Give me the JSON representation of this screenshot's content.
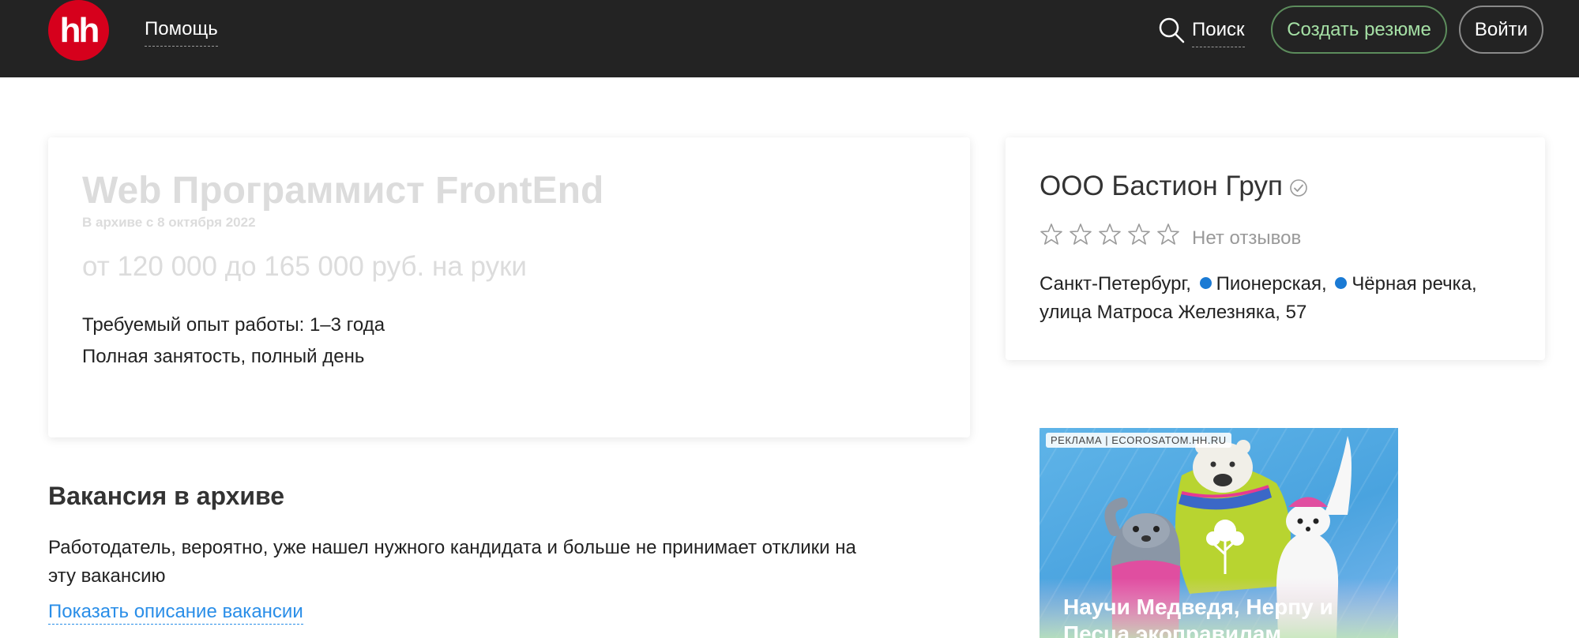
{
  "header": {
    "logo_text": "hh",
    "help_label": "Помощь",
    "search_label": "Поиск",
    "create_resume_label": "Создать резюме",
    "login_label": "Войти"
  },
  "vacancy": {
    "title": "Web Программист FrontEnd",
    "archived_note": "В архиве с 8 октября 2022",
    "salary": "от 120 000 до 165 000 руб. на руки",
    "experience": "Требуемый опыт работы: 1–3 года",
    "employment": "Полная занятость, полный день"
  },
  "archive_notice": {
    "heading": "Вакансия в архиве",
    "text": "Работодатель, вероятно, уже нашел нужного кандидата и больше не принимает отклики на эту вакансию",
    "show_description_link": "Показать описание вакансии"
  },
  "company": {
    "name": "ООО Бастион Груп",
    "rating_stars": 0,
    "reviews_text": "Нет отзывов",
    "city": "Санкт-Петербург,",
    "metro_1": "Пионерская,",
    "metro_2": "Чёрная речка,",
    "street": "улица Матроса Железняка, 57",
    "metro_color": "#1a7ad4"
  },
  "ad": {
    "label": "РЕКЛАМА | ECOROSATOM.HH.RU",
    "caption": "Научи Медведя, Нерпу и Песца экоправилам"
  },
  "colors": {
    "header_bg": "#232323",
    "brand_red": "#d6001c",
    "link_blue": "#2a8ee8",
    "resume_green": "#a5e0a5"
  }
}
